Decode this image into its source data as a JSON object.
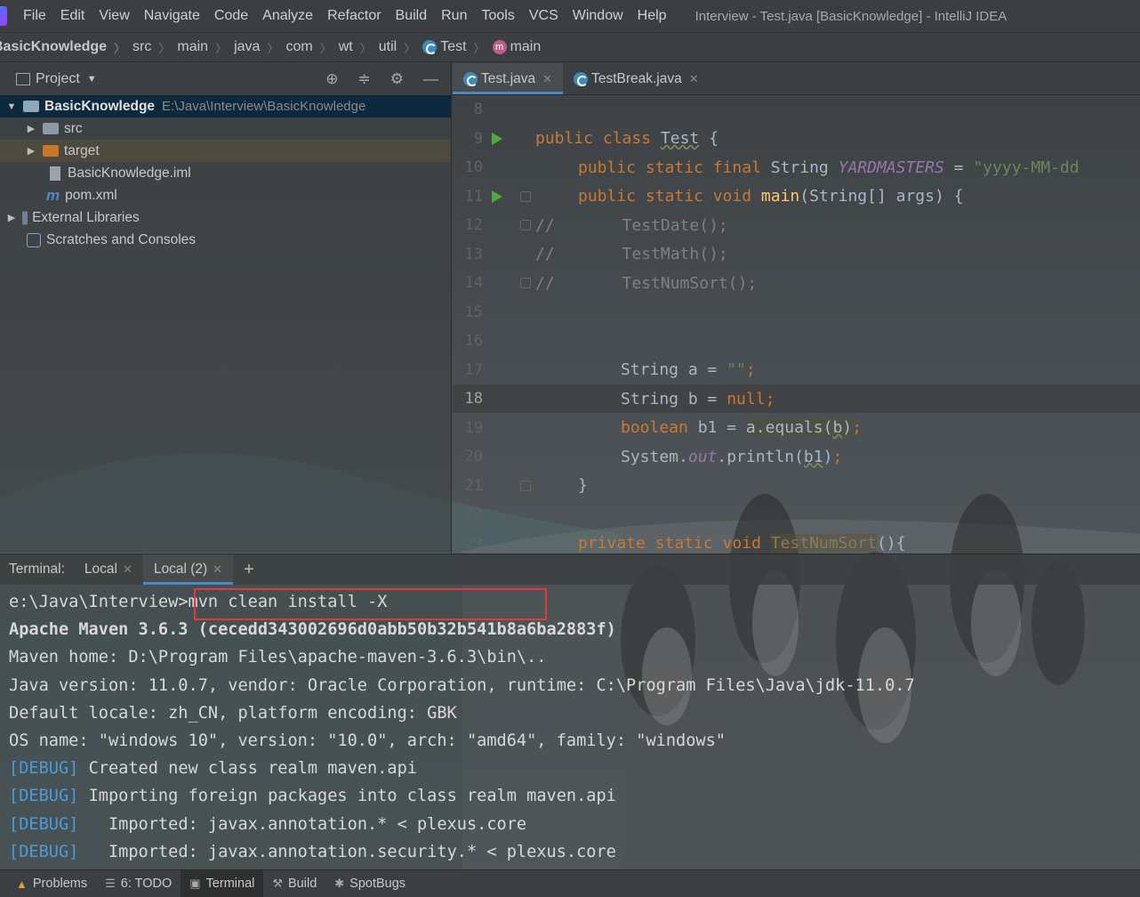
{
  "menubar": {
    "items": [
      {
        "label": "File"
      },
      {
        "label": "Edit"
      },
      {
        "label": "View"
      },
      {
        "label": "Navigate"
      },
      {
        "label": "Code"
      },
      {
        "label": "Analyze"
      },
      {
        "label": "Refactor"
      },
      {
        "label": "Build"
      },
      {
        "label": "Run"
      },
      {
        "label": "Tools"
      },
      {
        "label": "VCS"
      },
      {
        "label": "Window"
      },
      {
        "label": "Help"
      }
    ],
    "window_title": "Interview - Test.java [BasicKnowledge] - IntelliJ IDEA"
  },
  "breadcrumb": {
    "items": [
      "BasicKnowledge",
      "src",
      "main",
      "java",
      "com",
      "wt",
      "util",
      "Test",
      "main"
    ]
  },
  "project": {
    "header": "Project",
    "tree": [
      {
        "label": "BasicKnowledge",
        "hint": "E:\\Java\\Interview\\BasicKnowledge"
      },
      {
        "label": "src"
      },
      {
        "label": "target"
      },
      {
        "label": "BasicKnowledge.iml"
      },
      {
        "label": "pom.xml"
      },
      {
        "label": "External Libraries"
      },
      {
        "label": "Scratches and Consoles"
      }
    ]
  },
  "editor": {
    "tabs": [
      {
        "label": "Test.java",
        "active": true
      },
      {
        "label": "TestBreak.java",
        "active": false
      }
    ],
    "current_line": 18,
    "lines": [
      {
        "n": "8"
      },
      {
        "n": "9"
      },
      {
        "n": "10"
      },
      {
        "n": "11"
      },
      {
        "n": "12"
      },
      {
        "n": "13"
      },
      {
        "n": "14"
      },
      {
        "n": "15"
      },
      {
        "n": "16"
      },
      {
        "n": "17"
      },
      {
        "n": "18"
      },
      {
        "n": "19"
      },
      {
        "n": "20"
      },
      {
        "n": "21"
      },
      {
        "n": "22"
      },
      {
        "n": "23"
      }
    ],
    "code": {
      "l9_kw": "public class ",
      "l9_name": "Test",
      "l9_rest": " {",
      "l10_kw": "public static final ",
      "l10_type": "String ",
      "l10_const": "YARDMASTERS",
      "l10_eq": " = ",
      "l10_str": "\"yyyy-MM-dd",
      "l11_kw": "public static void ",
      "l11_fn": "main",
      "l11_rest": "(String[] args) {",
      "l12": "//       TestDate();",
      "l13": "//       TestMath();",
      "l14": "//       TestNumSort();",
      "l17_a": "String a = ",
      "l17_str": "\"\"",
      "l17_end": ";",
      "l18_a": "String b = ",
      "l18_kw": "null",
      "l18_end": ";",
      "l19_kw": "boolean ",
      "l19_a": "b1 = ",
      "l19_call": "a.equals(",
      "l19_arg": "b",
      "l19_close": ")",
      "l19_end": ";",
      "l20_a": "System.",
      "l20_out": "out",
      "l20_b": ".println(",
      "l20_arg": "b1",
      "l20_c": ")",
      "l20_end": ";",
      "l21": "}",
      "l23_kw": "private static void ",
      "l23_fn": "TestNumSort",
      "l23_rest": "(){"
    }
  },
  "terminal": {
    "label": "Terminal:",
    "tabs": [
      {
        "label": "Local",
        "active": false
      },
      {
        "label": "Local (2)",
        "active": true
      }
    ],
    "add": "+",
    "lines": [
      {
        "prefix": "e:\\Java\\Interview",
        "text": ">mvn clean install -X"
      },
      {
        "text": "Apache Maven 3.6.3 (cecedd343002696d0abb50b32b541b8a6ba2883f)"
      },
      {
        "text": "Maven home: D:\\Program Files\\apache-maven-3.6.3\\bin\\.."
      },
      {
        "text": "Java version: 11.0.7, vendor: Oracle Corporation, runtime: C:\\Program Files\\Java\\jdk-11.0.7"
      },
      {
        "text": "Default locale: zh_CN, platform encoding: GBK"
      },
      {
        "text": "OS name: \"windows 10\", version: \"10.0\", arch: \"amd64\", family: \"windows\""
      },
      {
        "tag": "[DEBUG]",
        "text": " Created new class realm maven.api"
      },
      {
        "tag": "[DEBUG]",
        "text": " Importing foreign packages into class realm maven.api"
      },
      {
        "tag": "[DEBUG]",
        "text": "   Imported: javax.annotation.* < plexus.core"
      },
      {
        "tag": "[DEBUG]",
        "text": "   Imported: javax.annotation.security.* < plexus.core"
      }
    ]
  },
  "bottom_tools": [
    {
      "label": "Problems",
      "icon": "warning-icon"
    },
    {
      "label": "6: TODO",
      "icon": "list-icon"
    },
    {
      "label": "Terminal",
      "icon": "terminal-icon",
      "active": true
    },
    {
      "label": "Build",
      "icon": "hammer-icon"
    },
    {
      "label": "SpotBugs",
      "icon": "bug-icon"
    }
  ]
}
